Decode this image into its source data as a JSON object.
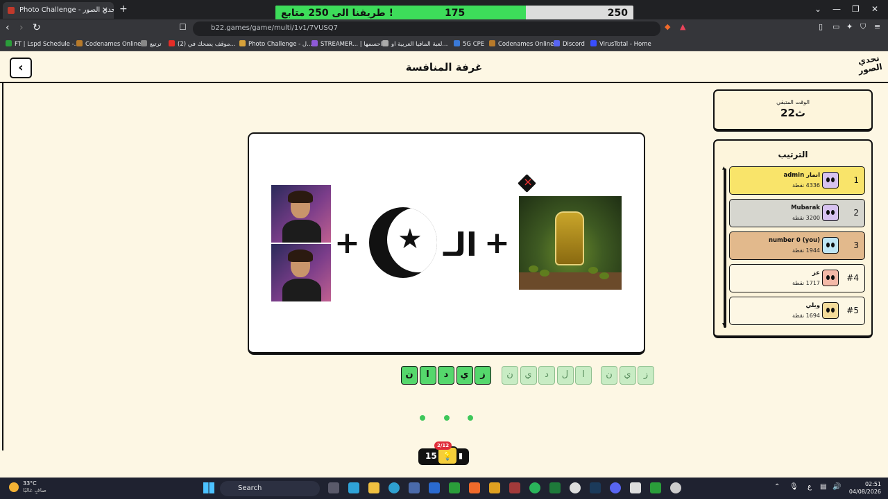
{
  "browser": {
    "tab_title": "Photo Challenge - لعبة تحدي الصور",
    "tab_close": "✕",
    "new_tab": "+",
    "url": "b22.games/game/multi/1v1/7VUSQ7",
    "bookmarks": [
      "FT | Lspd Schedule -...",
      "Codenames Online",
      "ترتيع",
      "(2) موقف يضحك في...",
      "Photo Challenge - ل...",
      "STREAMER... | احسمها",
      "لعبة المافيا العربية او...",
      "5G CPE",
      "Codenames Online",
      "Discord",
      "VirusTotal - Home"
    ]
  },
  "overlay": {
    "goal": "250",
    "current": "175",
    "progress_fraction": 0.7,
    "message": "طريقنا الى 250 متابع !",
    "fill_color": "#3ddc5a"
  },
  "header": {
    "title": "غرفة المنافسة",
    "back_icon": "‹",
    "logo_text": "تحدي الصور"
  },
  "timer": {
    "label": "الوقت المتبقي",
    "value": "22ث"
  },
  "ranking": {
    "title": "الترتيب",
    "players": [
      {
        "position": "1",
        "name": "انمار admin",
        "points": "4336 نقطة",
        "bg": "#f9e46a",
        "avatar_bg": "#d7c2f0"
      },
      {
        "position": "2",
        "name": "Mubarak",
        "points": "3200 نقطة",
        "bg": "#d6d6cf",
        "avatar_bg": "#d7c2f0"
      },
      {
        "position": "3",
        "name": "number 0 (you)",
        "points": "1944 نقطة",
        "bg": "#e2b98c",
        "avatar_bg": "#bfe6f5"
      },
      {
        "position": "#4",
        "name": "عز",
        "points": "1717 نقطة",
        "bg": "#fdf7e4",
        "avatar_bg": "#f4b9a8"
      },
      {
        "position": "#5",
        "name": "ويلي",
        "points": "1694 نقطة",
        "bg": "#fdf7e4",
        "avatar_bg": "#f4dc9a"
      }
    ]
  },
  "puzzle": {
    "prefix_text": "الـ",
    "answer_tiles": [
      "ن",
      "ا",
      "د",
      "ي",
      "ز"
    ],
    "hint_group_1": [
      "ن",
      "ي",
      "د",
      "ل",
      "ا"
    ],
    "hint_group_2": [
      "ن",
      "ي",
      "ز"
    ]
  },
  "hint": {
    "count": "15",
    "badge": "2/12",
    "icon": "💡"
  },
  "taskbar": {
    "temperature": "33°C",
    "weather": "صافٍ غالبًا",
    "search": "Search",
    "time": "02:51",
    "date": "04/08/2026",
    "lang": "ع"
  }
}
